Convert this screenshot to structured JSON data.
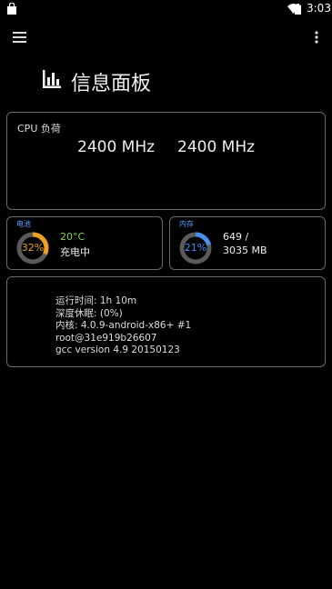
{
  "status_bar": {
    "time": "3:03"
  },
  "toolbar": {
    "menu_icon": "hamburger-menu-icon",
    "more_icon": "more-vert-icon"
  },
  "page": {
    "title": "信息面板",
    "title_icon": "bar-chart-icon"
  },
  "cpu": {
    "label": "CPU 负荷",
    "freqs": [
      "2400 MHz",
      "2400 MHz"
    ]
  },
  "battery": {
    "tag": "电池",
    "percent": 32,
    "percent_text": "32%",
    "temperature": "20°C",
    "status": "充电中",
    "colors": {
      "ring": "#f0a020",
      "value": "#f0a020",
      "temp": "#8ad24a"
    }
  },
  "memory": {
    "tag": "内存",
    "percent": 21,
    "percent_text": "21%",
    "used": "649 /",
    "total": "3035 MB",
    "colors": {
      "ring": "#4a8ef0",
      "value": "#4a8ef0"
    }
  },
  "system": {
    "lines": [
      "运行时间: 1h 10m",
      "深度休眠: (0%)",
      "内核: 4.0.9-android-x86+ #1",
      "root@31e919b26607",
      "gcc version 4.9 20150123"
    ]
  },
  "colors": {
    "background": "#000000",
    "card_border": "#6a6a6a",
    "accent": "#5aa0ff"
  }
}
